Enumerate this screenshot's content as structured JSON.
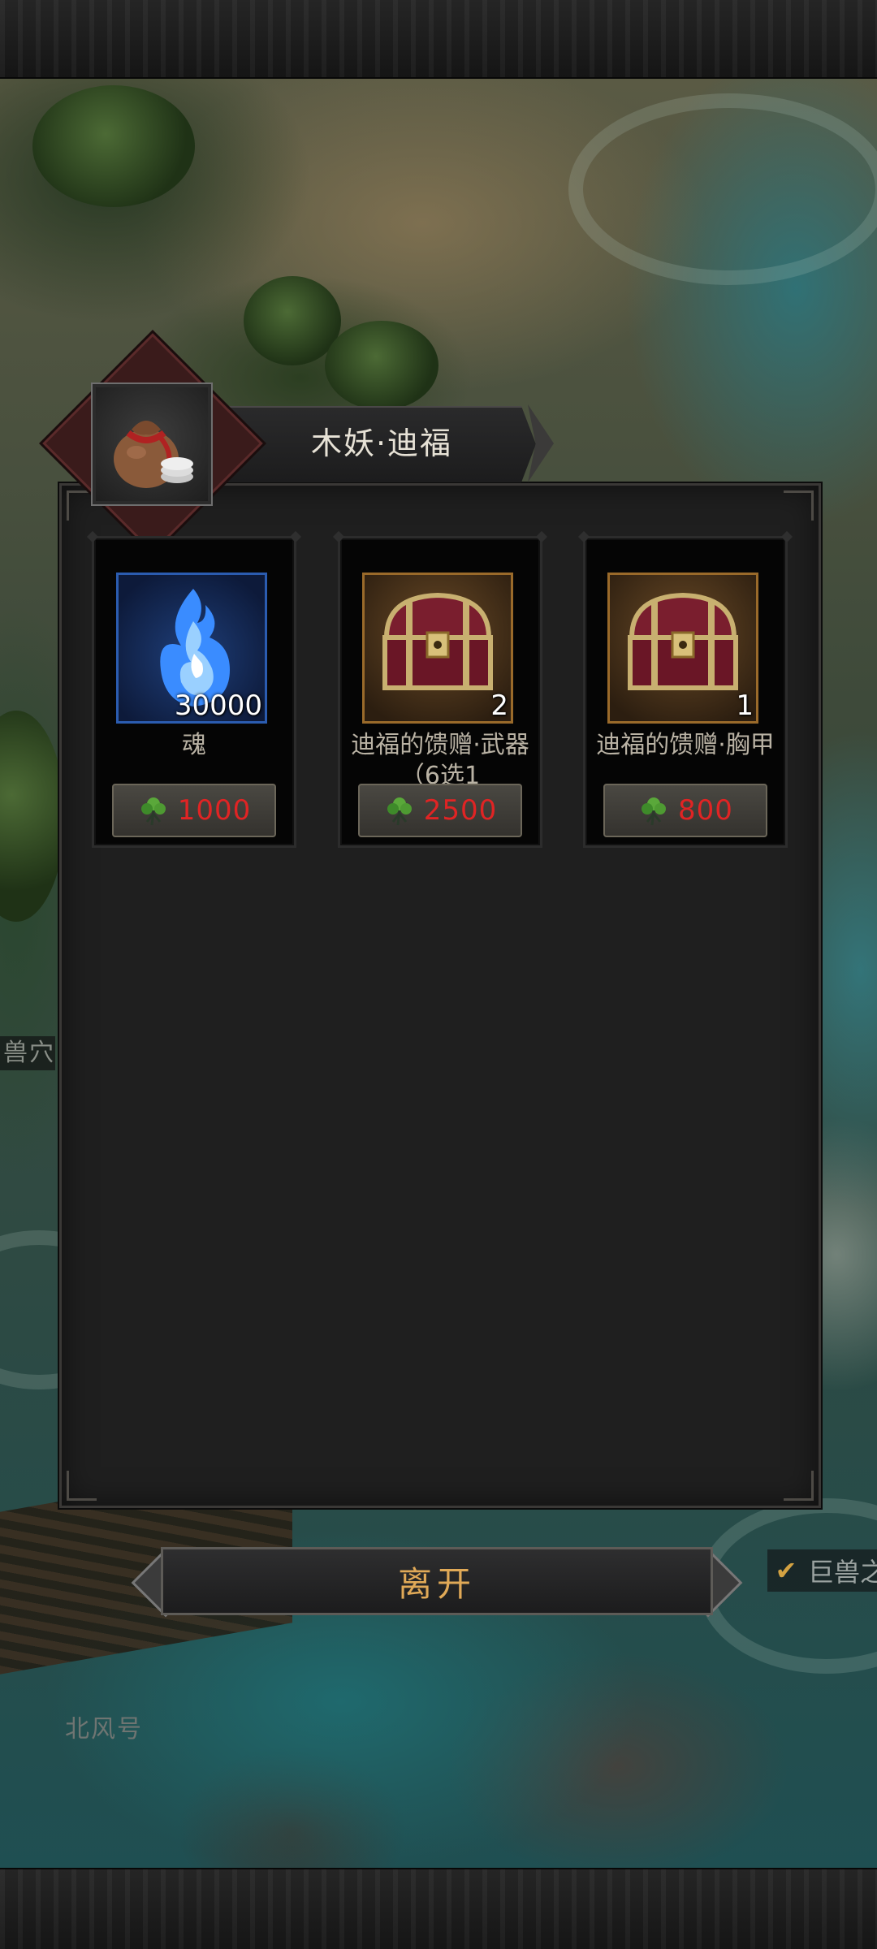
{
  "map": {
    "labels": {
      "beast": "兽穴",
      "north": "北风号"
    },
    "quest_tag": "巨兽之"
  },
  "dialog": {
    "title": "木妖·迪福",
    "portrait_icon": "money-bag-icon",
    "items": [
      {
        "name": "魂",
        "quantity": "30000",
        "icon": "blue-soul-flame-icon",
        "rarity_color": "#2b5cb0",
        "price": "1000",
        "currency_icon": "green-herb-icon"
      },
      {
        "name": "迪福的馈赠·武器（6选1",
        "quantity": "2",
        "icon": "treasure-chest-icon",
        "rarity_color": "#9a6a2a",
        "price": "2500",
        "currency_icon": "green-herb-icon"
      },
      {
        "name": "迪福的馈赠·胸甲",
        "quantity": "1",
        "icon": "treasure-chest-icon",
        "rarity_color": "#9a6a2a",
        "price": "800",
        "currency_icon": "green-herb-icon"
      }
    ],
    "leave_label": "离开"
  },
  "colors": {
    "price_text": "#e02424",
    "leave_text": "#e0a957",
    "title_text": "#e7e2d6"
  }
}
